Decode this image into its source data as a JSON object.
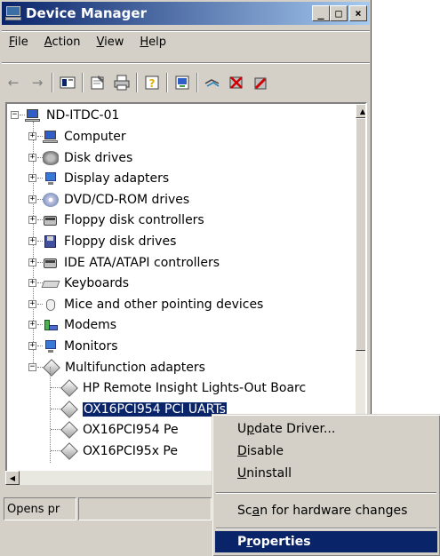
{
  "window": {
    "title": "Device Manager",
    "buttons": {
      "minimize": "_",
      "maximize": "□",
      "close": "×"
    }
  },
  "menubar": [
    {
      "label": "File",
      "mnemonic": "F",
      "rest": "ile"
    },
    {
      "label": "Action",
      "mnemonic": "A",
      "rest": "ction"
    },
    {
      "label": "View",
      "mnemonic": "V",
      "rest": "iew"
    },
    {
      "label": "Help",
      "mnemonic": "H",
      "rest": "elp"
    }
  ],
  "toolbar": {
    "icons": [
      "back-arrow-icon",
      "forward-arrow-icon",
      "show-hide-console-tree-icon",
      "properties-icon",
      "print-icon",
      "help-icon",
      "update-driver-icon",
      "scan-hardware-icon",
      "uninstall-icon",
      "disable-icon"
    ]
  },
  "tree": {
    "root": "ND-ITDC-01",
    "categories": [
      "Computer",
      "Disk drives",
      "Display adapters",
      "DVD/CD-ROM drives",
      "Floppy disk controllers",
      "Floppy disk drives",
      "IDE ATA/ATAPI controllers",
      "Keyboards",
      "Mice and other pointing devices",
      "Modems",
      "Monitors",
      "Multifunction adapters"
    ],
    "children": [
      "HP Remote Insight Lights-Out Boarc",
      "OX16PCI954 PCI UARTs",
      "OX16PCI954 Pe",
      "OX16PCI95x Pe"
    ],
    "selected_index": 1
  },
  "statusbar": {
    "text": "Opens pr"
  },
  "context_menu": {
    "items": [
      {
        "label": "Update Driver...",
        "underline": "p"
      },
      {
        "label": "Disable",
        "underline": "D"
      },
      {
        "label": "Uninstall",
        "underline": "U"
      },
      {
        "label": "Scan for hardware changes",
        "underline": "a"
      },
      {
        "label": "Properties",
        "underline": "r"
      }
    ],
    "active_item": "Properties"
  }
}
